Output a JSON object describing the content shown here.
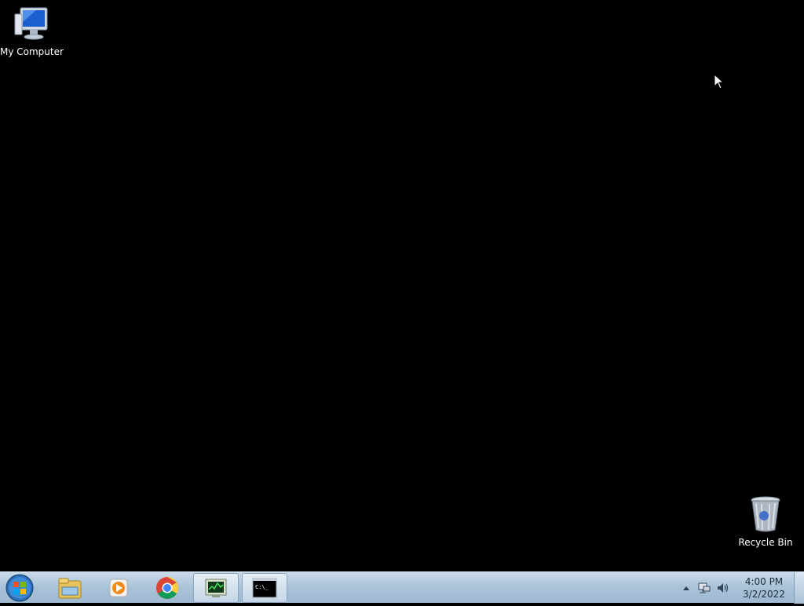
{
  "desktop": {
    "icons": [
      {
        "label": "My Computer",
        "icon": "computer-icon"
      },
      {
        "label": "Recycle Bin",
        "icon": "recycle-bin-icon"
      }
    ]
  },
  "taskbar": {
    "start": {
      "icon": "windows-start-orb-icon"
    },
    "pinned": [
      {
        "icon": "windows-explorer-icon"
      },
      {
        "icon": "media-player-icon"
      },
      {
        "icon": "chrome-icon"
      },
      {
        "icon": "task-manager-icon",
        "active": true
      },
      {
        "icon": "command-prompt-icon",
        "active": true,
        "text": "C:\\_"
      }
    ],
    "tray": {
      "icons": [
        "show-hidden-icons-arrow",
        "network-icon",
        "volume-icon"
      ],
      "time": "4:00 PM",
      "date": "3/2/2022"
    }
  },
  "colors": {
    "desktop_bg": "#000000",
    "taskbar_top": "#c9dbea",
    "taskbar_bottom": "#9fb9d1"
  }
}
